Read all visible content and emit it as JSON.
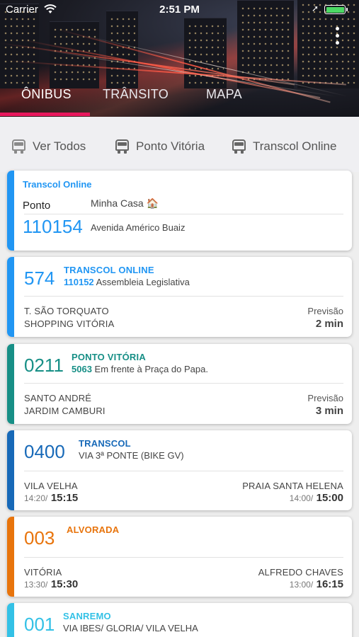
{
  "status_bar": {
    "carrier": "Carrier",
    "time": "2:51 PM",
    "battery_level": 1.0,
    "battery_color": "#4cd964"
  },
  "tabs": [
    {
      "label": "ÔNIBUS",
      "selected": true
    },
    {
      "label": "TRÂNSITO",
      "selected": false
    },
    {
      "label": "MAPA",
      "selected": false
    }
  ],
  "accent_color": "#e8175d",
  "filters": [
    {
      "label": "Ver Todos",
      "icon": "bus-icon"
    },
    {
      "label": "Ponto Vitória",
      "icon": "bus-icon"
    },
    {
      "label": "Transcol Online",
      "icon": "bus-icon"
    }
  ],
  "favorite_stop": {
    "title": "Transcol Online",
    "label": "Ponto",
    "name": "Minha Casa 🏠",
    "code": "110154",
    "address": "Avenida Américo Buaiz",
    "color": "#2196f3"
  },
  "cards": [
    {
      "route": "574",
      "agency": "TRANSCOL ONLINE",
      "stop_code": "110152",
      "stop_name": "Assembleia Legislativa",
      "dest_line1": "T. SÃO TORQUATO",
      "dest_line2": "SHOPPING VITÓRIA",
      "forecast_label": "Previsão",
      "forecast_value": "2 min",
      "color": "#2196f3"
    },
    {
      "route": "0211",
      "agency": "PONTO VITÓRIA",
      "stop_code": "5063",
      "stop_name": "Em frente à Praça do Papa.",
      "dest_line1": "SANTO ANDRÉ",
      "dest_line2": "JARDIM CAMBURI",
      "forecast_label": "Previsão",
      "forecast_value": "3 min",
      "color": "#178f86"
    },
    {
      "route": "0400",
      "agency": "TRANSCOL",
      "subtitle": "VIA 3ª PONTE (BIKE GV)",
      "origin": "VILA VELHA",
      "origin_time_small": "14:20/",
      "origin_time": "15:15",
      "destination": "PRAIA SANTA HELENA",
      "dest_time_small": "14:00/",
      "dest_time": "15:00",
      "color": "#1769b8"
    },
    {
      "route": "003",
      "agency": "ALVORADA",
      "origin": "VITÓRIA",
      "origin_time_small": "13:30/",
      "origin_time": "15:30",
      "destination": "ALFREDO CHAVES",
      "dest_time_small": "13:00/",
      "dest_time": "16:15",
      "color": "#e8740c"
    },
    {
      "route": "001",
      "agency": "SANREMO",
      "subtitle": "VIA IBES/ GLORIA/ VILA VELHA",
      "color": "#33c1e6"
    }
  ]
}
